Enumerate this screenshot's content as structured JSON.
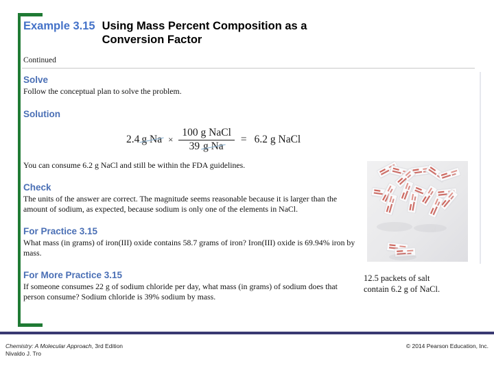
{
  "slide": {
    "example_label": "Example 3.15",
    "title": "Using Mass Percent Composition as a Conversion Factor",
    "continued": "Continued",
    "accent_blue": "#4472c8",
    "heading_blue": "#4a6fb5",
    "bracket_green": "#1f7a34",
    "footer_rule_navy": "#3a3a72"
  },
  "sections": {
    "solve_heading": "Solve",
    "solve_text": "Follow the conceptual plan to solve the problem.",
    "solution_heading": "Solution",
    "result_text": "You can consume 6.2 g NaCl and still be within the FDA guidelines.",
    "check_heading": "Check",
    "check_text": "The units of the answer are correct. The magnitude seems reasonable because it is larger than the amount of sodium, as expected, because sodium is only one of the elements in NaCl.",
    "for_practice_heading": "For Practice 3.15",
    "for_practice_text": "What mass (in grams) of iron(III) oxide contains 58.7 grams of iron? Iron(III) oxide is 69.94% iron by mass.",
    "for_more_practice_heading": "For More Practice 3.15",
    "for_more_practice_text": "If someone consumes 22 g of sodium chloride per day, what mass (in grams) of sodium does that person consume? Sodium chloride is 39% sodium by mass."
  },
  "equation": {
    "given_value": "2.4",
    "given_unit": "g Na",
    "times_symbol": "×",
    "numerator": "100 g NaCl",
    "denominator_value": "39",
    "denominator_unit": "g Na",
    "equals_symbol": "=",
    "answer": "6.2 g NaCl"
  },
  "photo": {
    "caption_line1": "12.5 packets of salt",
    "caption_line2": "contain 6.2 g of NaCl.",
    "alt": "photograph of scattered white salt packets with red printing"
  },
  "footer": {
    "book_title": "Chemistry: A Molecular Approach",
    "edition": ", 3rd Edition",
    "author": "Nivaldo J. Tro",
    "copyright": "© 2014 Pearson Education, Inc."
  }
}
